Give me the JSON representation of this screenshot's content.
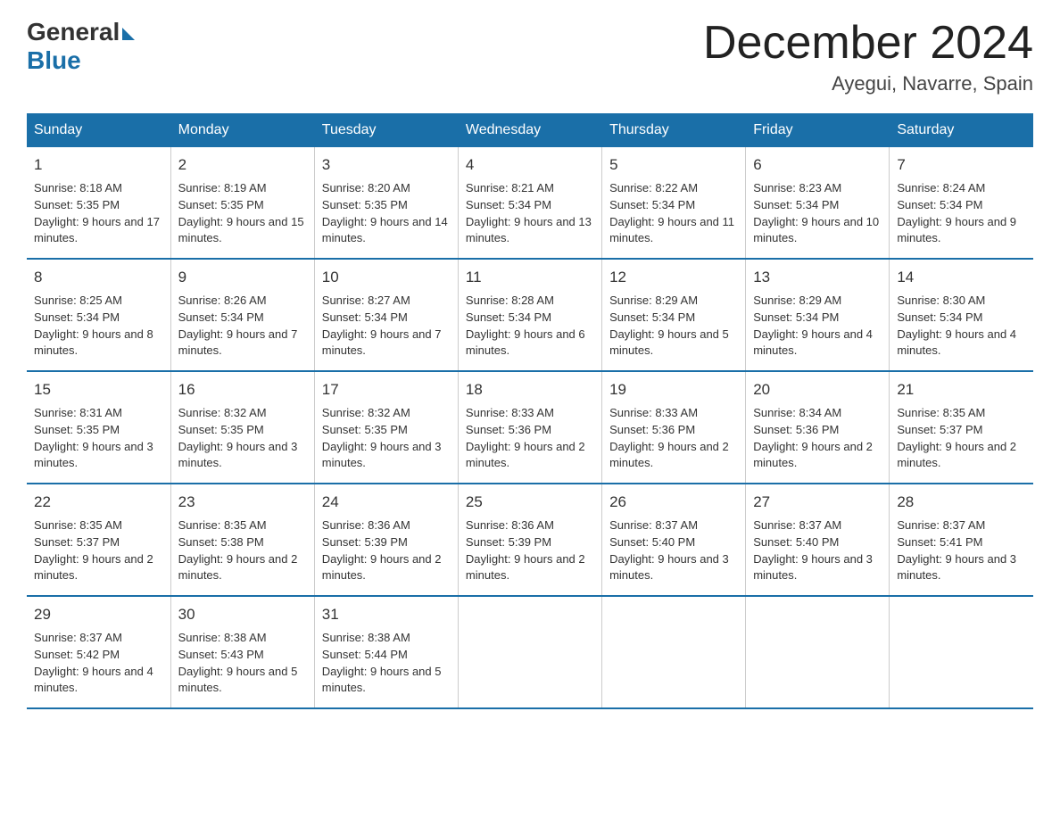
{
  "logo": {
    "general": "General",
    "blue": "Blue"
  },
  "title": "December 2024",
  "location": "Ayegui, Navarre, Spain",
  "days_of_week": [
    "Sunday",
    "Monday",
    "Tuesday",
    "Wednesday",
    "Thursday",
    "Friday",
    "Saturday"
  ],
  "weeks": [
    [
      {
        "day": "1",
        "sunrise": "8:18 AM",
        "sunset": "5:35 PM",
        "daylight": "9 hours and 17 minutes."
      },
      {
        "day": "2",
        "sunrise": "8:19 AM",
        "sunset": "5:35 PM",
        "daylight": "9 hours and 15 minutes."
      },
      {
        "day": "3",
        "sunrise": "8:20 AM",
        "sunset": "5:35 PM",
        "daylight": "9 hours and 14 minutes."
      },
      {
        "day": "4",
        "sunrise": "8:21 AM",
        "sunset": "5:34 PM",
        "daylight": "9 hours and 13 minutes."
      },
      {
        "day": "5",
        "sunrise": "8:22 AM",
        "sunset": "5:34 PM",
        "daylight": "9 hours and 11 minutes."
      },
      {
        "day": "6",
        "sunrise": "8:23 AM",
        "sunset": "5:34 PM",
        "daylight": "9 hours and 10 minutes."
      },
      {
        "day": "7",
        "sunrise": "8:24 AM",
        "sunset": "5:34 PM",
        "daylight": "9 hours and 9 minutes."
      }
    ],
    [
      {
        "day": "8",
        "sunrise": "8:25 AM",
        "sunset": "5:34 PM",
        "daylight": "9 hours and 8 minutes."
      },
      {
        "day": "9",
        "sunrise": "8:26 AM",
        "sunset": "5:34 PM",
        "daylight": "9 hours and 7 minutes."
      },
      {
        "day": "10",
        "sunrise": "8:27 AM",
        "sunset": "5:34 PM",
        "daylight": "9 hours and 7 minutes."
      },
      {
        "day": "11",
        "sunrise": "8:28 AM",
        "sunset": "5:34 PM",
        "daylight": "9 hours and 6 minutes."
      },
      {
        "day": "12",
        "sunrise": "8:29 AM",
        "sunset": "5:34 PM",
        "daylight": "9 hours and 5 minutes."
      },
      {
        "day": "13",
        "sunrise": "8:29 AM",
        "sunset": "5:34 PM",
        "daylight": "9 hours and 4 minutes."
      },
      {
        "day": "14",
        "sunrise": "8:30 AM",
        "sunset": "5:34 PM",
        "daylight": "9 hours and 4 minutes."
      }
    ],
    [
      {
        "day": "15",
        "sunrise": "8:31 AM",
        "sunset": "5:35 PM",
        "daylight": "9 hours and 3 minutes."
      },
      {
        "day": "16",
        "sunrise": "8:32 AM",
        "sunset": "5:35 PM",
        "daylight": "9 hours and 3 minutes."
      },
      {
        "day": "17",
        "sunrise": "8:32 AM",
        "sunset": "5:35 PM",
        "daylight": "9 hours and 3 minutes."
      },
      {
        "day": "18",
        "sunrise": "8:33 AM",
        "sunset": "5:36 PM",
        "daylight": "9 hours and 2 minutes."
      },
      {
        "day": "19",
        "sunrise": "8:33 AM",
        "sunset": "5:36 PM",
        "daylight": "9 hours and 2 minutes."
      },
      {
        "day": "20",
        "sunrise": "8:34 AM",
        "sunset": "5:36 PM",
        "daylight": "9 hours and 2 minutes."
      },
      {
        "day": "21",
        "sunrise": "8:35 AM",
        "sunset": "5:37 PM",
        "daylight": "9 hours and 2 minutes."
      }
    ],
    [
      {
        "day": "22",
        "sunrise": "8:35 AM",
        "sunset": "5:37 PM",
        "daylight": "9 hours and 2 minutes."
      },
      {
        "day": "23",
        "sunrise": "8:35 AM",
        "sunset": "5:38 PM",
        "daylight": "9 hours and 2 minutes."
      },
      {
        "day": "24",
        "sunrise": "8:36 AM",
        "sunset": "5:39 PM",
        "daylight": "9 hours and 2 minutes."
      },
      {
        "day": "25",
        "sunrise": "8:36 AM",
        "sunset": "5:39 PM",
        "daylight": "9 hours and 2 minutes."
      },
      {
        "day": "26",
        "sunrise": "8:37 AM",
        "sunset": "5:40 PM",
        "daylight": "9 hours and 3 minutes."
      },
      {
        "day": "27",
        "sunrise": "8:37 AM",
        "sunset": "5:40 PM",
        "daylight": "9 hours and 3 minutes."
      },
      {
        "day": "28",
        "sunrise": "8:37 AM",
        "sunset": "5:41 PM",
        "daylight": "9 hours and 3 minutes."
      }
    ],
    [
      {
        "day": "29",
        "sunrise": "8:37 AM",
        "sunset": "5:42 PM",
        "daylight": "9 hours and 4 minutes."
      },
      {
        "day": "30",
        "sunrise": "8:38 AM",
        "sunset": "5:43 PM",
        "daylight": "9 hours and 5 minutes."
      },
      {
        "day": "31",
        "sunrise": "8:38 AM",
        "sunset": "5:44 PM",
        "daylight": "9 hours and 5 minutes."
      },
      null,
      null,
      null,
      null
    ]
  ]
}
